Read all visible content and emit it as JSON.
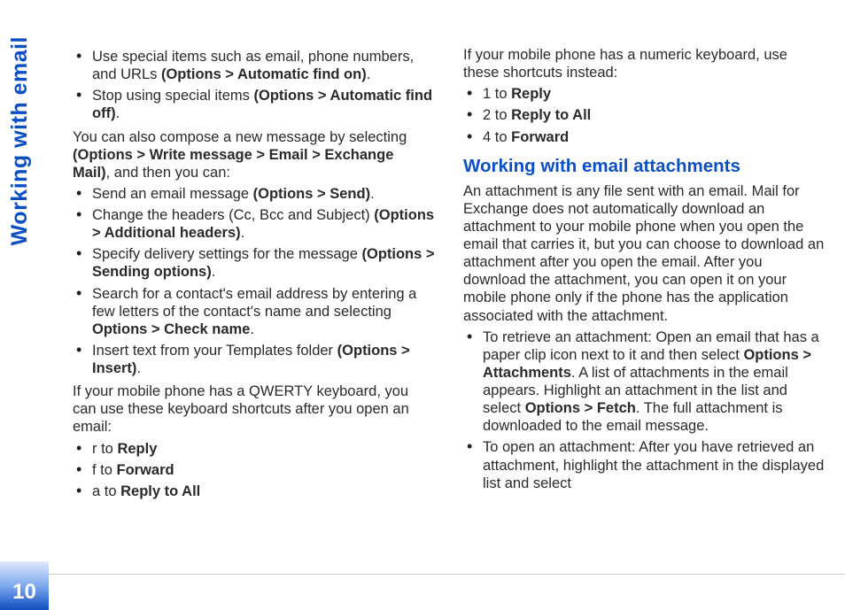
{
  "side_title": "Working with email",
  "page_number": "10",
  "col1": {
    "bullets_a": [
      {
        "pre": "Use special items such as email, phone numbers, and URLs ",
        "bold": "(Options > Automatic find on)",
        "post": "."
      },
      {
        "pre": "Stop using special items ",
        "bold": "(Options > Automatic find off)",
        "post": "."
      }
    ],
    "para_a_pre": "You can also compose a new message by selecting ",
    "para_a_bold": "(Options > Write message > Email > Exchange Mail)",
    "para_a_post": ", and then you can:",
    "bullets_b": [
      {
        "pre": "Send an email message ",
        "bold": "(Options > Send)",
        "post": "."
      },
      {
        "pre": "Change the headers (Cc, Bcc and Subject) ",
        "bold": "(Options > Additional headers)",
        "post": "."
      },
      {
        "pre": "Specify delivery settings for the message ",
        "bold": "(Options > Sending options)",
        "post": "."
      },
      {
        "pre": "Search for a contact's email address by entering a few letters of the contact's name and selecting ",
        "bold": "Options > Check name",
        "post": "."
      },
      {
        "pre": "Insert text from your Templates folder ",
        "bold": "(Options > Insert)",
        "post": "."
      }
    ],
    "para_b": "If your mobile phone has a QWERTY keyboard, you can use these keyboard shortcuts after you open an email:",
    "bullets_c": [
      {
        "pre": "r to ",
        "bold": "Reply",
        "post": ""
      },
      {
        "pre": "f to ",
        "bold": "Forward",
        "post": ""
      },
      {
        "pre": "a to ",
        "bold": "Reply to All",
        "post": ""
      }
    ]
  },
  "col2": {
    "para_a": "If your mobile phone has a numeric keyboard, use these shortcuts instead:",
    "bullets_a": [
      {
        "pre": "1 to ",
        "bold": "Reply",
        "post": ""
      },
      {
        "pre": "2 to ",
        "bold": "Reply to All",
        "post": ""
      },
      {
        "pre": "4 to ",
        "bold": "Forward",
        "post": ""
      }
    ],
    "heading": "Working with email attachments",
    "para_b": "An attachment is any file sent with an email. Mail for Exchange does not automatically download an attachment to your mobile phone when you open the email that carries it, but you can choose to download an attachment after you open the email. After you download the attachment, you can open it on your mobile phone only if the phone has the application associated with the attachment.",
    "bullets_b": [
      {
        "pre": "To retrieve an attachment: Open an email that has a paper clip icon next to it and then select ",
        "bold": "Options > Attachments",
        "mid": ". A list of attachments in the email appears. Highlight an attachment in the list and select ",
        "bold2": "Options > Fetch",
        "post": ". The full attachment is downloaded to the email message."
      },
      {
        "pre": "To open an attachment: After you have retrieved an attachment, highlight the attachment in the displayed list and select",
        "bold": "",
        "post": ""
      }
    ]
  }
}
